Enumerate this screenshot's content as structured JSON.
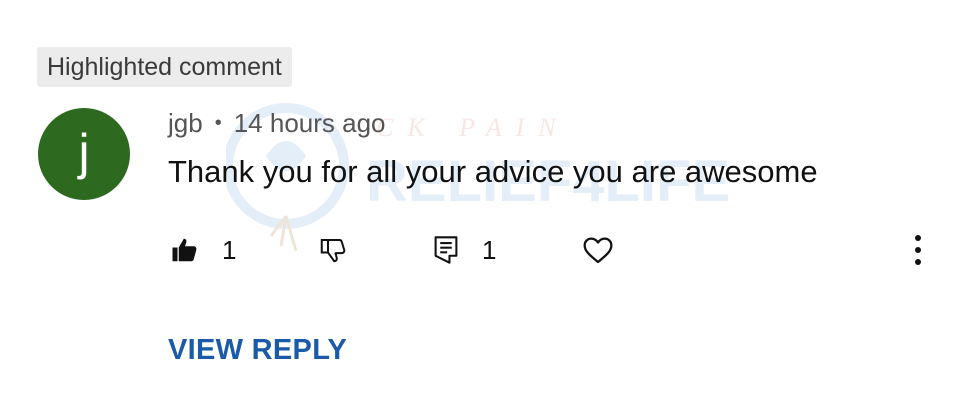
{
  "badge": {
    "label": "Highlighted comment"
  },
  "comment": {
    "avatar_letter": "j",
    "avatar_color": "#2d6a1f",
    "author": "jgb",
    "separator": "•",
    "timestamp": "14 hours ago",
    "text": "Thank you for all your advice you are awesome"
  },
  "actions": {
    "like_icon": "thumbs-up-filled-icon",
    "like_count": "1",
    "dislike_icon": "thumbs-down-outline-icon",
    "reply_icon": "comment-icon",
    "reply_count": "1",
    "heart_icon": "heart-outline-icon",
    "more_icon": "more-vertical-icon"
  },
  "view_reply": {
    "label": "VIEW REPLY"
  },
  "watermark": {
    "top": "CK PAIN",
    "brand": "RELIEF4LIFE"
  },
  "colors": {
    "link": "#1a5aa8",
    "badge_bg": "#ececec"
  }
}
